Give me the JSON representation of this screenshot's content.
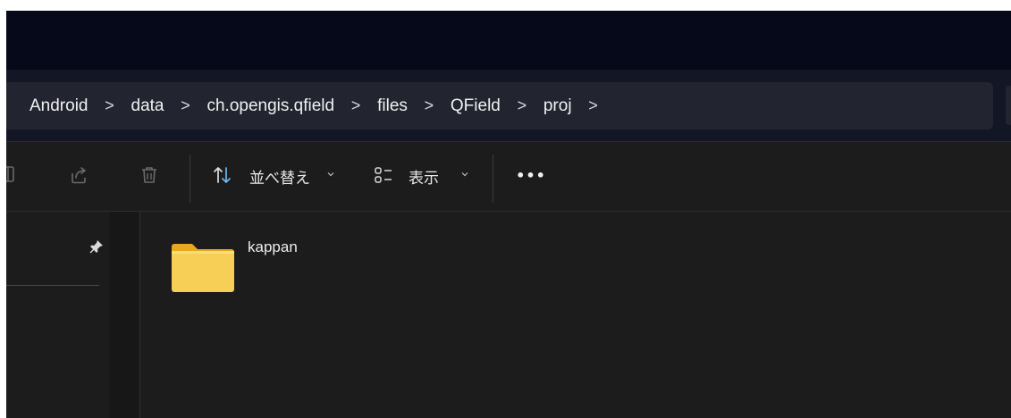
{
  "breadcrumb": {
    "items": [
      "Android",
      "data",
      "ch.opengis.qfield",
      "files",
      "QField",
      "proj"
    ],
    "separator": ">"
  },
  "toolbar": {
    "sort_label": "並べ替え",
    "view_label": "表示",
    "more_label": "•••",
    "icons": [
      "copy-icon",
      "share-icon",
      "delete-icon",
      "sort-icon",
      "view-icon",
      "more-icon"
    ]
  },
  "navigation": {
    "pin_icon": "pin-icon"
  },
  "content": {
    "items": [
      {
        "name": "kappan",
        "type": "folder",
        "icon": "folder-icon"
      }
    ]
  },
  "colors": {
    "background": "#1c1c1c",
    "titlebar": "#05091a",
    "address_bar": "#222530",
    "folder_yellow": "#f5c842",
    "text": "#f0f0f0",
    "sort_arrow_blue": "#6cb8f0"
  }
}
